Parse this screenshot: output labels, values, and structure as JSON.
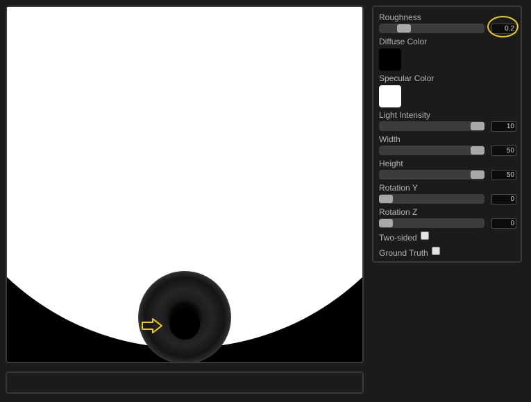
{
  "controls": {
    "roughness": {
      "label": "Roughness",
      "value": "0.2",
      "fraction": 0.2
    },
    "diffuse_color": {
      "label": "Diffuse Color",
      "color": "#000000"
    },
    "specular_color": {
      "label": "Specular Color",
      "color": "#ffffff"
    },
    "light_intensity": {
      "label": "Light Intensity",
      "value": "10",
      "fraction": 1.0
    },
    "width": {
      "label": "Width",
      "value": "50",
      "fraction": 1.0
    },
    "height": {
      "label": "Height",
      "value": "50",
      "fraction": 1.0
    },
    "rotation_y": {
      "label": "Rotation Y",
      "value": "0",
      "fraction": 0.0
    },
    "rotation_z": {
      "label": "Rotation Z",
      "value": "0",
      "fraction": 0.0
    },
    "two_sided": {
      "label": "Two-sided",
      "checked": false
    },
    "ground_truth": {
      "label": "Ground Truth",
      "checked": false
    }
  },
  "colors": {
    "background": "#1b1b1b",
    "slider_track": "#3c3c3c",
    "slider_thumb": "#a8a8a8",
    "highlight": "#f0cc10"
  },
  "annotations": {
    "arrow_icon": "arrow-right-icon",
    "highlight": "circle-highlight"
  }
}
